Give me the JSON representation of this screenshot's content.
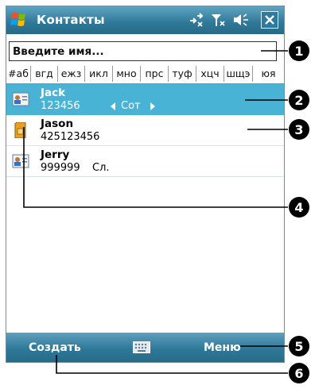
{
  "titlebar": {
    "title": "Контакты"
  },
  "search": {
    "placeholder": "Введите имя..."
  },
  "tabs": [
    "#аб",
    "вгд",
    "ежз",
    "икл",
    "мно",
    "прс",
    "туф",
    "хцч",
    "шщэ",
    "юя"
  ],
  "contacts": [
    {
      "name": "Jack",
      "number": "123456",
      "type": "Сот",
      "selected": true
    },
    {
      "name": "Jason",
      "number": "425123456",
      "type": ""
    },
    {
      "name": "Jerry",
      "number": "999999",
      "type": "Сл."
    }
  ],
  "bottombar": {
    "left": "Создать",
    "right": "Меню"
  },
  "callouts": [
    "1",
    "2",
    "3",
    "4",
    "5",
    "6"
  ],
  "colors": {
    "accent": "#2f7898",
    "selection": "#49b3d5"
  }
}
